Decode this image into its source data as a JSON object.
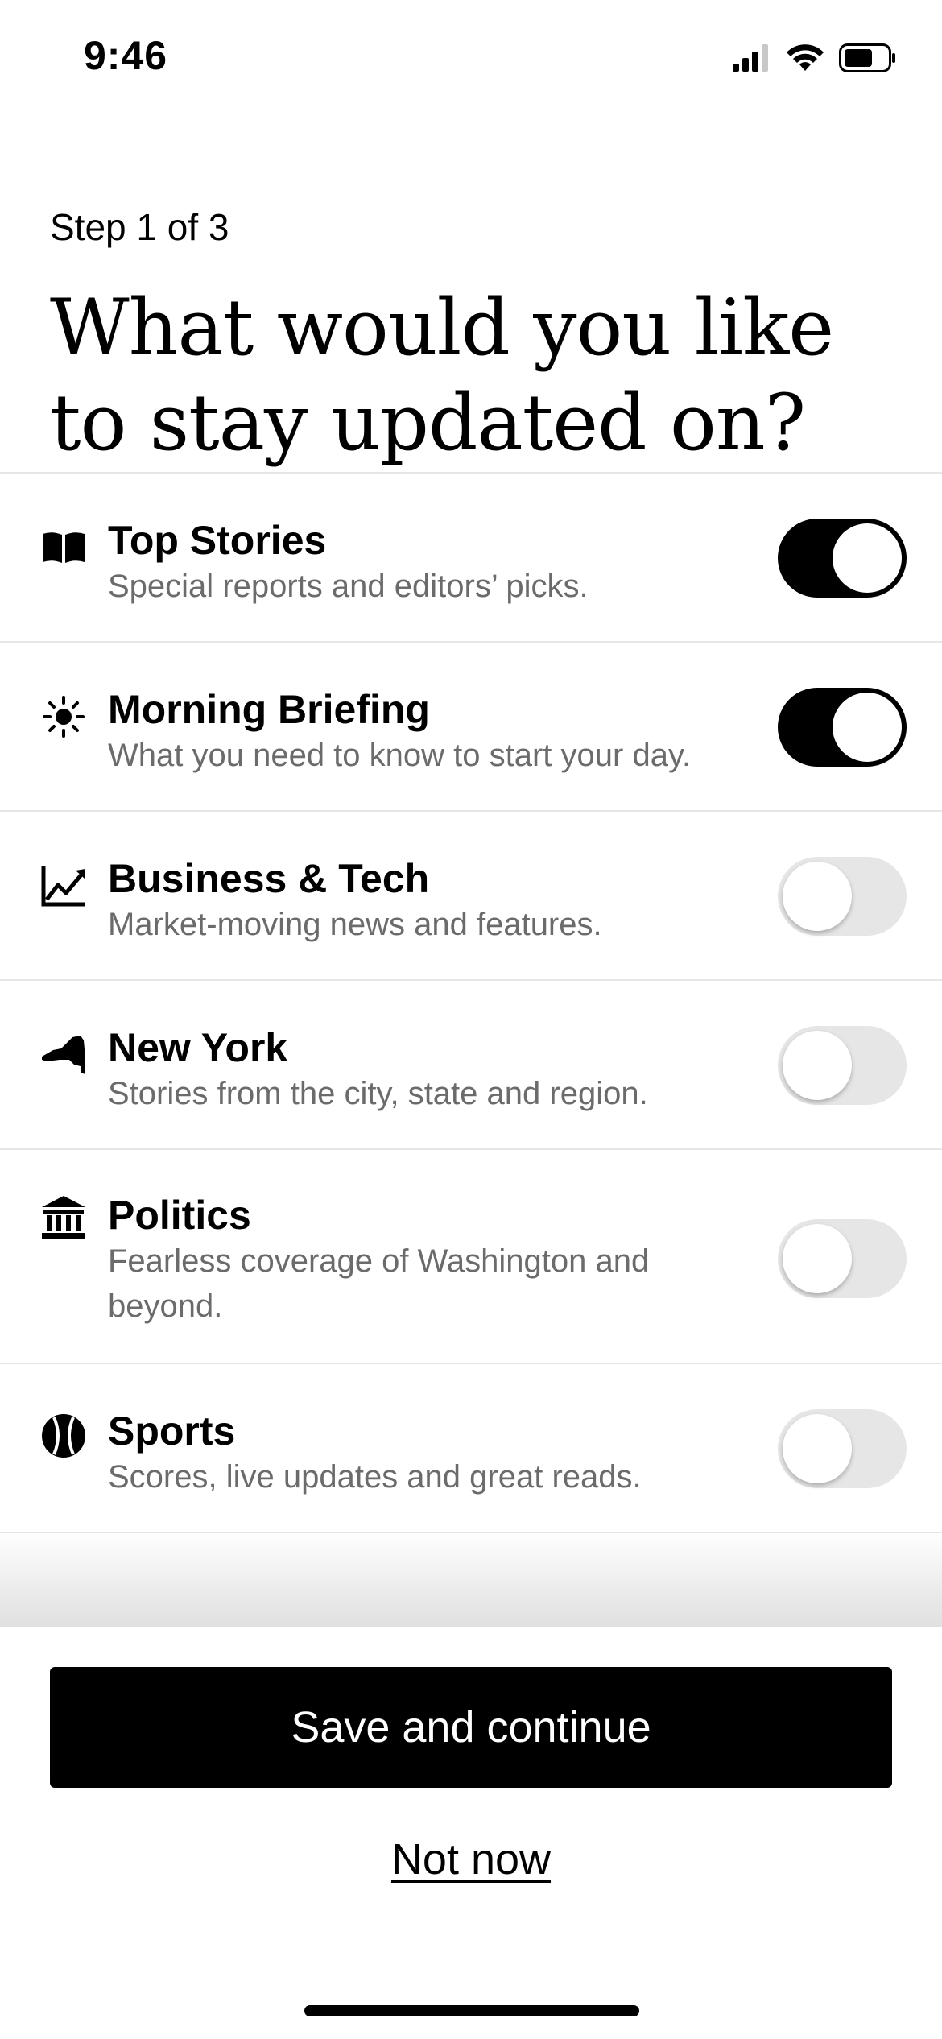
{
  "status_bar": {
    "time": "9:46",
    "icons": [
      "cellular-signal-icon",
      "wifi-icon",
      "battery-icon"
    ]
  },
  "header": {
    "step": "Step 1 of 3",
    "title": "What would you like to stay updated on?"
  },
  "topics": [
    {
      "icon": "open-book-icon",
      "title": "Top Stories",
      "description": "Special reports and editors’ picks.",
      "enabled": true
    },
    {
      "icon": "sun-icon",
      "title": "Morning Briefing",
      "description": "What you need to know to start your day.",
      "enabled": true
    },
    {
      "icon": "line-chart-icon",
      "title": "Business & Tech",
      "description": "Market-moving news and features.",
      "enabled": false
    },
    {
      "icon": "new-york-state-icon",
      "title": "New York",
      "description": "Stories from the city, state and region.",
      "enabled": false
    },
    {
      "icon": "capitol-building-icon",
      "title": "Politics",
      "description": "Fearless coverage of Washington and beyond.",
      "enabled": false
    },
    {
      "icon": "baseball-icon",
      "title": "Sports",
      "description": "Scores, live updates and great reads.",
      "enabled": false
    }
  ],
  "actions": {
    "save_label": "Save and continue",
    "not_now_label": "Not now"
  },
  "colors": {
    "toggle_on": "#000000",
    "toggle_off": "#e6e6e6",
    "description_text": "#6b6b6b",
    "divider": "#e6e6e6"
  }
}
